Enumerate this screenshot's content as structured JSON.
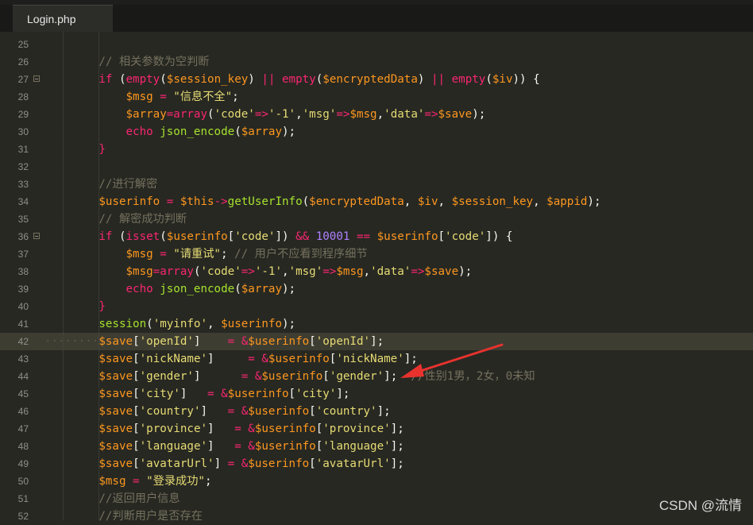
{
  "tab": {
    "title": "Login.php"
  },
  "watermark": "CSDN @流情",
  "lines": [
    {
      "n": "25",
      "fold": false,
      "tokens": []
    },
    {
      "n": "26",
      "fold": false,
      "tokens": [
        [
          "        ",
          "p"
        ],
        [
          "// 相关参数为空判断",
          "c"
        ]
      ]
    },
    {
      "n": "27",
      "fold": true,
      "tokens": [
        [
          "        ",
          "p"
        ],
        [
          "if ",
          "k"
        ],
        [
          "(",
          "p"
        ],
        [
          "empty",
          "k"
        ],
        [
          "(",
          "p"
        ],
        [
          "$session_key",
          "v"
        ],
        [
          ") ",
          "p"
        ],
        [
          "||",
          "k"
        ],
        [
          " ",
          "p"
        ],
        [
          "empty",
          "k"
        ],
        [
          "(",
          "p"
        ],
        [
          "$encryptedData",
          "v"
        ],
        [
          ") ",
          "p"
        ],
        [
          "||",
          "k"
        ],
        [
          " ",
          "p"
        ],
        [
          "empty",
          "k"
        ],
        [
          "(",
          "p"
        ],
        [
          "$iv",
          "v"
        ],
        [
          ")) {",
          "p"
        ]
      ]
    },
    {
      "n": "28",
      "fold": false,
      "tokens": [
        [
          "            ",
          "p"
        ],
        [
          "$msg",
          "v"
        ],
        [
          " = ",
          "k"
        ],
        [
          "\"信息不全\"",
          "s"
        ],
        [
          ";",
          "p"
        ]
      ]
    },
    {
      "n": "29",
      "fold": false,
      "tokens": [
        [
          "            ",
          "p"
        ],
        [
          "$array",
          "v"
        ],
        [
          "=",
          "k"
        ],
        [
          "array",
          "k"
        ],
        [
          "(",
          "p"
        ],
        [
          "'code'",
          "s"
        ],
        [
          "=>",
          "k"
        ],
        [
          "'-1'",
          "s"
        ],
        [
          ",",
          "p"
        ],
        [
          "'msg'",
          "s"
        ],
        [
          "=>",
          "k"
        ],
        [
          "$msg",
          "v"
        ],
        [
          ",",
          "p"
        ],
        [
          "'data'",
          "s"
        ],
        [
          "=>",
          "k"
        ],
        [
          "$save",
          "v"
        ],
        [
          ");",
          "p"
        ]
      ]
    },
    {
      "n": "30",
      "fold": false,
      "tokens": [
        [
          "            ",
          "p"
        ],
        [
          "echo",
          "k"
        ],
        [
          " ",
          "p"
        ],
        [
          "json_encode",
          "f"
        ],
        [
          "(",
          "p"
        ],
        [
          "$array",
          "v"
        ],
        [
          ");",
          "p"
        ]
      ]
    },
    {
      "n": "31",
      "fold": false,
      "tokens": [
        [
          "        ",
          "p"
        ],
        [
          "}",
          "k"
        ]
      ]
    },
    {
      "n": "32",
      "fold": false,
      "tokens": []
    },
    {
      "n": "33",
      "fold": false,
      "tokens": [
        [
          "        ",
          "p"
        ],
        [
          "//进行解密",
          "c"
        ]
      ]
    },
    {
      "n": "34",
      "fold": false,
      "tokens": [
        [
          "        ",
          "p"
        ],
        [
          "$userinfo",
          "v"
        ],
        [
          " = ",
          "k"
        ],
        [
          "$this",
          "v"
        ],
        [
          "->",
          "k"
        ],
        [
          "getUserInfo",
          "f"
        ],
        [
          "(",
          "p"
        ],
        [
          "$encryptedData",
          "v"
        ],
        [
          ", ",
          "p"
        ],
        [
          "$iv",
          "v"
        ],
        [
          ", ",
          "p"
        ],
        [
          "$session_key",
          "v"
        ],
        [
          ", ",
          "p"
        ],
        [
          "$appid",
          "v"
        ],
        [
          ");",
          "p"
        ]
      ]
    },
    {
      "n": "35",
      "fold": false,
      "tokens": [
        [
          "        ",
          "p"
        ],
        [
          "// 解密成功判断",
          "c"
        ]
      ]
    },
    {
      "n": "36",
      "fold": true,
      "tokens": [
        [
          "        ",
          "p"
        ],
        [
          "if ",
          "k"
        ],
        [
          "(",
          "p"
        ],
        [
          "isset",
          "k"
        ],
        [
          "(",
          "p"
        ],
        [
          "$userinfo",
          "v"
        ],
        [
          "[",
          "p"
        ],
        [
          "'code'",
          "s"
        ],
        [
          "]) ",
          "p"
        ],
        [
          "&&",
          "k"
        ],
        [
          " ",
          "p"
        ],
        [
          "10001",
          "n"
        ],
        [
          " == ",
          "k"
        ],
        [
          "$userinfo",
          "v"
        ],
        [
          "[",
          "p"
        ],
        [
          "'code'",
          "s"
        ],
        [
          "]) {",
          "p"
        ]
      ]
    },
    {
      "n": "37",
      "fold": false,
      "tokens": [
        [
          "            ",
          "p"
        ],
        [
          "$msg",
          "v"
        ],
        [
          " = ",
          "k"
        ],
        [
          "\"请重试\"",
          "s"
        ],
        [
          "; ",
          "p"
        ],
        [
          "// 用户不应看到程序细节",
          "c"
        ]
      ]
    },
    {
      "n": "38",
      "fold": false,
      "tokens": [
        [
          "            ",
          "p"
        ],
        [
          "$msg",
          "v"
        ],
        [
          "=",
          "k"
        ],
        [
          "array",
          "k"
        ],
        [
          "(",
          "p"
        ],
        [
          "'code'",
          "s"
        ],
        [
          "=>",
          "k"
        ],
        [
          "'-1'",
          "s"
        ],
        [
          ",",
          "p"
        ],
        [
          "'msg'",
          "s"
        ],
        [
          "=>",
          "k"
        ],
        [
          "$msg",
          "v"
        ],
        [
          ",",
          "p"
        ],
        [
          "'data'",
          "s"
        ],
        [
          "=>",
          "k"
        ],
        [
          "$save",
          "v"
        ],
        [
          ");",
          "p"
        ]
      ]
    },
    {
      "n": "39",
      "fold": false,
      "tokens": [
        [
          "            ",
          "p"
        ],
        [
          "echo",
          "k"
        ],
        [
          " ",
          "p"
        ],
        [
          "json_encode",
          "f"
        ],
        [
          "(",
          "p"
        ],
        [
          "$array",
          "v"
        ],
        [
          ");",
          "p"
        ]
      ]
    },
    {
      "n": "40",
      "fold": false,
      "tokens": [
        [
          "        ",
          "p"
        ],
        [
          "}",
          "k"
        ]
      ]
    },
    {
      "n": "41",
      "fold": false,
      "tokens": [
        [
          "        ",
          "p"
        ],
        [
          "session",
          "f"
        ],
        [
          "(",
          "p"
        ],
        [
          "'myinfo'",
          "s"
        ],
        [
          ", ",
          "p"
        ],
        [
          "$userinfo",
          "v"
        ],
        [
          ");",
          "p"
        ]
      ]
    },
    {
      "n": "42",
      "fold": false,
      "active": true,
      "tokens": [
        [
          "········",
          "dots"
        ],
        [
          "$save",
          "v"
        ],
        [
          "[",
          "p"
        ],
        [
          "'openId'",
          "s"
        ],
        [
          "]",
          "p"
        ],
        [
          "    = ",
          "k"
        ],
        [
          "&",
          "k"
        ],
        [
          "$userinfo",
          "v"
        ],
        [
          "[",
          "p"
        ],
        [
          "'openId'",
          "s"
        ],
        [
          "];",
          "p"
        ]
      ]
    },
    {
      "n": "43",
      "fold": false,
      "tokens": [
        [
          "        ",
          "p"
        ],
        [
          "$save",
          "v"
        ],
        [
          "[",
          "p"
        ],
        [
          "'nickName'",
          "s"
        ],
        [
          "]",
          "p"
        ],
        [
          "     = ",
          "k"
        ],
        [
          "&",
          "k"
        ],
        [
          "$userinfo",
          "v"
        ],
        [
          "[",
          "p"
        ],
        [
          "'nickName'",
          "s"
        ],
        [
          "];",
          "p"
        ]
      ]
    },
    {
      "n": "44",
      "fold": false,
      "tokens": [
        [
          "        ",
          "p"
        ],
        [
          "$save",
          "v"
        ],
        [
          "[",
          "p"
        ],
        [
          "'gender'",
          "s"
        ],
        [
          "]",
          "p"
        ],
        [
          "      = ",
          "k"
        ],
        [
          "&",
          "k"
        ],
        [
          "$userinfo",
          "v"
        ],
        [
          "[",
          "p"
        ],
        [
          "'gender'",
          "s"
        ],
        [
          "];  ",
          "p"
        ],
        [
          "//性别1男，2女，0未知",
          "c"
        ]
      ]
    },
    {
      "n": "45",
      "fold": false,
      "tokens": [
        [
          "        ",
          "p"
        ],
        [
          "$save",
          "v"
        ],
        [
          "[",
          "p"
        ],
        [
          "'city'",
          "s"
        ],
        [
          "]",
          "p"
        ],
        [
          "   = ",
          "k"
        ],
        [
          "&",
          "k"
        ],
        [
          "$userinfo",
          "v"
        ],
        [
          "[",
          "p"
        ],
        [
          "'city'",
          "s"
        ],
        [
          "];",
          "p"
        ]
      ]
    },
    {
      "n": "46",
      "fold": false,
      "tokens": [
        [
          "        ",
          "p"
        ],
        [
          "$save",
          "v"
        ],
        [
          "[",
          "p"
        ],
        [
          "'country'",
          "s"
        ],
        [
          "]",
          "p"
        ],
        [
          "   = ",
          "k"
        ],
        [
          "&",
          "k"
        ],
        [
          "$userinfo",
          "v"
        ],
        [
          "[",
          "p"
        ],
        [
          "'country'",
          "s"
        ],
        [
          "];",
          "p"
        ]
      ]
    },
    {
      "n": "47",
      "fold": false,
      "tokens": [
        [
          "        ",
          "p"
        ],
        [
          "$save",
          "v"
        ],
        [
          "[",
          "p"
        ],
        [
          "'province'",
          "s"
        ],
        [
          "]",
          "p"
        ],
        [
          "   = ",
          "k"
        ],
        [
          "&",
          "k"
        ],
        [
          "$userinfo",
          "v"
        ],
        [
          "[",
          "p"
        ],
        [
          "'province'",
          "s"
        ],
        [
          "];",
          "p"
        ]
      ]
    },
    {
      "n": "48",
      "fold": false,
      "tokens": [
        [
          "        ",
          "p"
        ],
        [
          "$save",
          "v"
        ],
        [
          "[",
          "p"
        ],
        [
          "'language'",
          "s"
        ],
        [
          "]",
          "p"
        ],
        [
          "   = ",
          "k"
        ],
        [
          "&",
          "k"
        ],
        [
          "$userinfo",
          "v"
        ],
        [
          "[",
          "p"
        ],
        [
          "'language'",
          "s"
        ],
        [
          "];",
          "p"
        ]
      ]
    },
    {
      "n": "49",
      "fold": false,
      "tokens": [
        [
          "        ",
          "p"
        ],
        [
          "$save",
          "v"
        ],
        [
          "[",
          "p"
        ],
        [
          "'avatarUrl'",
          "s"
        ],
        [
          "]",
          "p"
        ],
        [
          " = ",
          "k"
        ],
        [
          "&",
          "k"
        ],
        [
          "$userinfo",
          "v"
        ],
        [
          "[",
          "p"
        ],
        [
          "'avatarUrl'",
          "s"
        ],
        [
          "];",
          "p"
        ]
      ]
    },
    {
      "n": "50",
      "fold": false,
      "tokens": [
        [
          "        ",
          "p"
        ],
        [
          "$msg",
          "v"
        ],
        [
          " = ",
          "k"
        ],
        [
          "\"登录成功\"",
          "s"
        ],
        [
          ";",
          "p"
        ]
      ]
    },
    {
      "n": "51",
      "fold": false,
      "tokens": [
        [
          "        ",
          "p"
        ],
        [
          "//返回用户信息",
          "c"
        ]
      ]
    },
    {
      "n": "52",
      "fold": false,
      "tokens": [
        [
          "        ",
          "p"
        ],
        [
          "//判断用户是否存在",
          "c"
        ]
      ]
    }
  ]
}
